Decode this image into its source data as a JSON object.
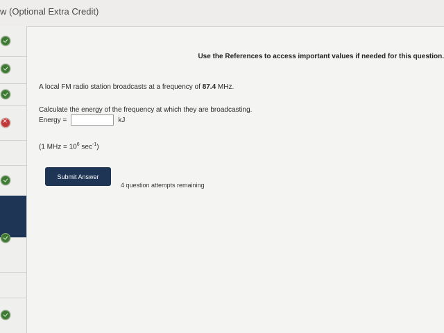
{
  "header": {
    "title": "w (Optional Extra Credit)"
  },
  "sidebar": {
    "items": [
      {
        "status": "correct"
      },
      {
        "status": "correct"
      },
      {
        "status": "correct"
      },
      {
        "status": "incorrect"
      },
      {
        "status": "none"
      },
      {
        "status": "correct"
      },
      {
        "status": "none",
        "active": true
      },
      {
        "status": "correct"
      },
      {
        "status": "none"
      },
      {
        "status": "correct"
      }
    ]
  },
  "question": {
    "references_note": "Use the References to access important values if needed for this question.",
    "text_before": "A local FM radio station broadcasts at a frequency of ",
    "frequency": "87.4",
    "text_after": " MHz.",
    "prompt": "Calculate the energy of the frequency at which they are broadcasting.",
    "energy_label": "Energy =",
    "energy_value": "",
    "unit": "kJ",
    "conversion_left": "(1 MHz = 10",
    "conversion_exp1": "6",
    "conversion_mid": " sec",
    "conversion_exp2": "-1",
    "conversion_right": ")"
  },
  "actions": {
    "submit_label": "Submit Answer",
    "attempts_text": "4 question attempts remaining"
  },
  "colors": {
    "accent": "#1e3556",
    "correct": "#3f7a34",
    "incorrect": "#c0393b"
  }
}
